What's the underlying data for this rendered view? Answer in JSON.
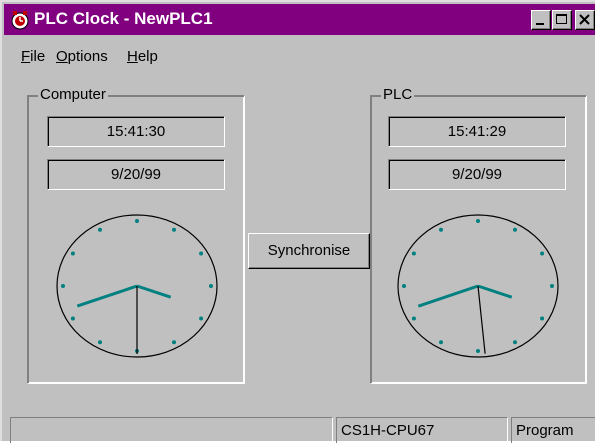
{
  "window": {
    "title": "PLC Clock - NewPLC1",
    "colors": {
      "title_bar": "#800080",
      "face": "#c0c0c0",
      "hand_accent": "#008080"
    }
  },
  "menu": {
    "items": [
      {
        "label": "File",
        "accel": "F",
        "rest": "ile"
      },
      {
        "label": "Options",
        "accel": "O",
        "rest": "ptions"
      },
      {
        "label": "Help",
        "accel": "H",
        "rest": "elp"
      }
    ]
  },
  "computer": {
    "label": "Computer",
    "time": "15:41:30",
    "date": "9/20/99",
    "clock": {
      "hour": 15,
      "minute": 41,
      "second": 30
    }
  },
  "plc": {
    "label": "PLC",
    "time": "15:41:29",
    "date": "9/20/99",
    "clock": {
      "hour": 15,
      "minute": 41,
      "second": 29
    }
  },
  "sync_button": {
    "label": "Synchronise"
  },
  "status": {
    "cpu": "CS1H-CPU67",
    "mode": "Program"
  }
}
